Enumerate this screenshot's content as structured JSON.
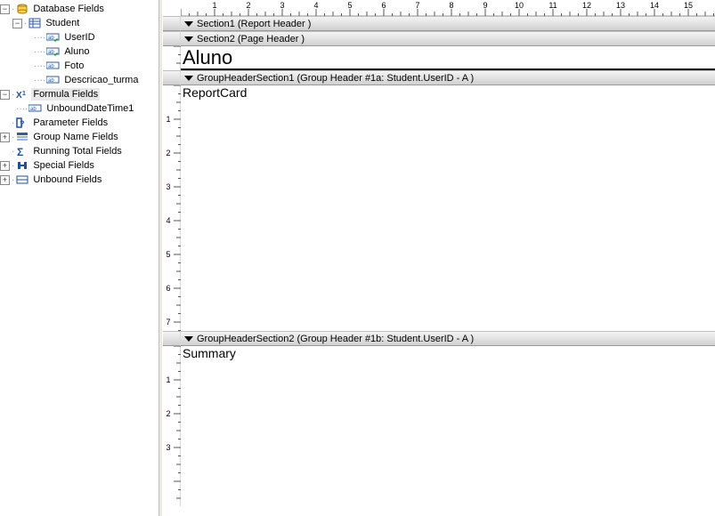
{
  "tree": {
    "database_fields": "Database Fields",
    "student": "Student",
    "userid": "UserID",
    "aluno": "Aluno",
    "foto": "Foto",
    "descricao": "Descricao_turma",
    "formula_fields": "Formula Fields",
    "unbound_dt": "UnboundDateTime1",
    "parameter_fields": "Parameter Fields",
    "group_name_fields": "Group Name Fields",
    "running_total_fields": "Running Total Fields",
    "special_fields": "Special Fields",
    "unbound_fields": "Unbound Fields"
  },
  "ruler": {
    "units": [
      "1",
      "2",
      "3",
      "4",
      "5",
      "6",
      "7",
      "8",
      "9",
      "10",
      "11",
      "12",
      "13",
      "14",
      "15"
    ]
  },
  "sections": {
    "s1": {
      "label": "Section1 (Report Header )"
    },
    "s2": {
      "label": "Section2 (Page Header )",
      "field": "Aluno"
    },
    "gh1": {
      "label": "GroupHeaderSection1 (Group Header #1a: Student.UserID - A )",
      "field": "ReportCard"
    },
    "gh2": {
      "label": "GroupHeaderSection2 (Group Header #1b: Student.UserID - A )",
      "field": "Summary"
    }
  },
  "vruler": {
    "gh1_units": [
      "1",
      "2",
      "3",
      "4",
      "5",
      "6",
      "7"
    ],
    "gh2_units": [
      "1",
      "2",
      "3"
    ]
  }
}
